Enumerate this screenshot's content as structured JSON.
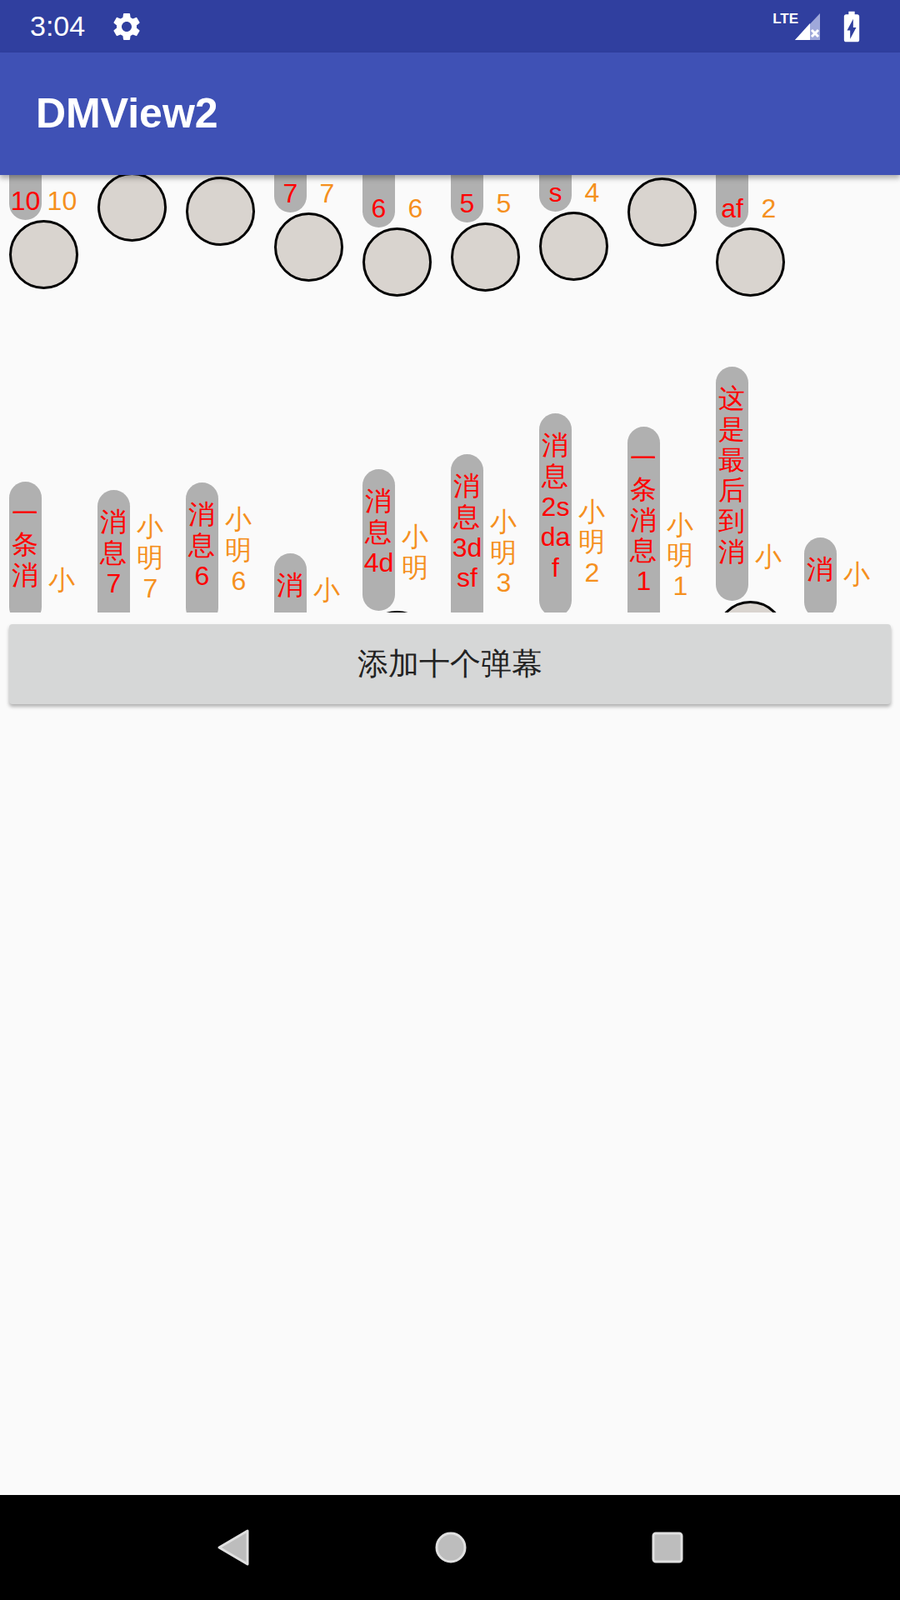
{
  "status_bar": {
    "time": "3:04",
    "network": "LTE"
  },
  "app_bar": {
    "title": "DMView2"
  },
  "danmaku": {
    "top_row": [
      {
        "message": "10",
        "name": "10"
      },
      {},
      {},
      {
        "message": "7",
        "name": "7"
      },
      {
        "message": "6",
        "name": "6"
      },
      {
        "message": "5",
        "name": "5"
      },
      {
        "message": "s",
        "name": "4"
      },
      {},
      {
        "message": "af",
        "name": "2"
      }
    ],
    "bottom_row": [
      {
        "message": "一条消",
        "name": "小"
      },
      {
        "message": "消息7",
        "name": "小明7"
      },
      {
        "message": "消息6",
        "name": "小明6"
      },
      {
        "message": "消",
        "name": "小"
      },
      {
        "message": "消息4d",
        "name": "小明"
      },
      {
        "message": "消息3dsf",
        "name": "小明3"
      },
      {
        "message": "消息2sdaf",
        "name": "小明2"
      },
      {
        "message": "一条消息1",
        "name": "小明1"
      },
      {
        "message": "这是最后到消",
        "name": "小"
      },
      {
        "message": "消",
        "name": "小"
      }
    ]
  },
  "button": {
    "label": "添加十个弹幕"
  }
}
